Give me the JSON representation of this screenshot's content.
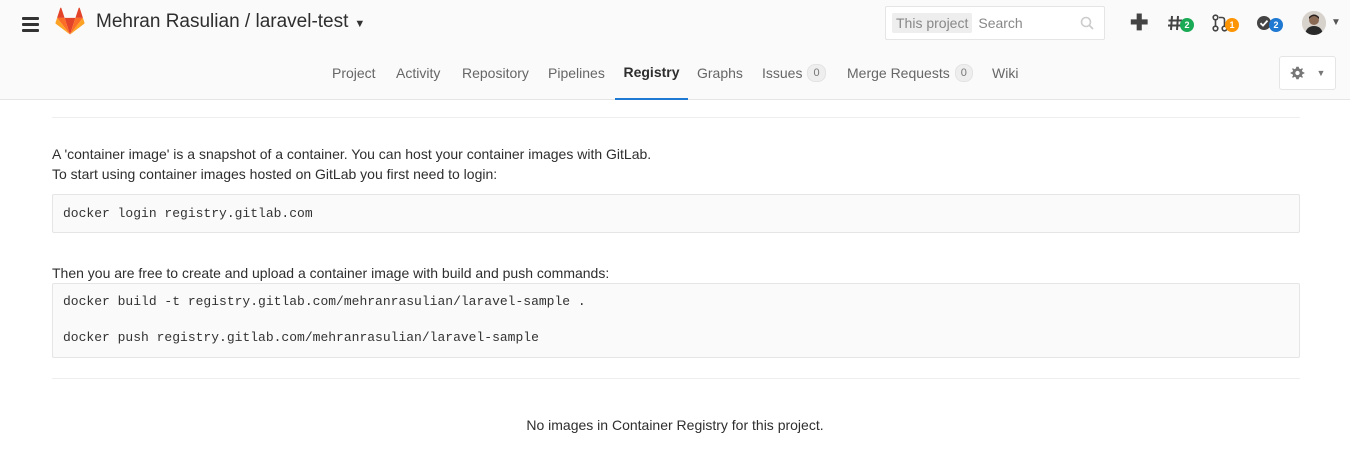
{
  "header": {
    "project_title": "Mehran Rasulian / laravel-test",
    "search": {
      "scope": "This project",
      "placeholder": "Search"
    },
    "badges": {
      "issues": "2",
      "merge_requests": "1",
      "todos": "2"
    }
  },
  "nav": {
    "tabs": [
      {
        "label": "Project"
      },
      {
        "label": "Activity"
      },
      {
        "label": "Repository"
      },
      {
        "label": "Pipelines"
      },
      {
        "label": "Registry",
        "active": true
      },
      {
        "label": "Graphs"
      },
      {
        "label": "Issues",
        "count": "0"
      },
      {
        "label": "Merge Requests",
        "count": "0"
      },
      {
        "label": "Wiki"
      }
    ]
  },
  "content": {
    "intro_line1": "A 'container image' is a snapshot of a container. You can host your container images with GitLab.",
    "intro_line2": "To start using container images hosted on GitLab you first need to login:",
    "login_command": "docker login registry.gitlab.com",
    "build_intro": "Then you are free to create and upload a container image with build and push commands:",
    "build_command": "docker build -t registry.gitlab.com/mehranrasulian/laravel-sample .",
    "push_command": "docker push registry.gitlab.com/mehranrasulian/laravel-sample",
    "empty_message": "No images in Container Registry for this project."
  },
  "colors": {
    "accent": "#1f78d1",
    "badge_green": "#1aaa55",
    "badge_orange": "#fc9403",
    "badge_blue": "#1f78d1",
    "gitlab_orange": "#fc6d26"
  }
}
